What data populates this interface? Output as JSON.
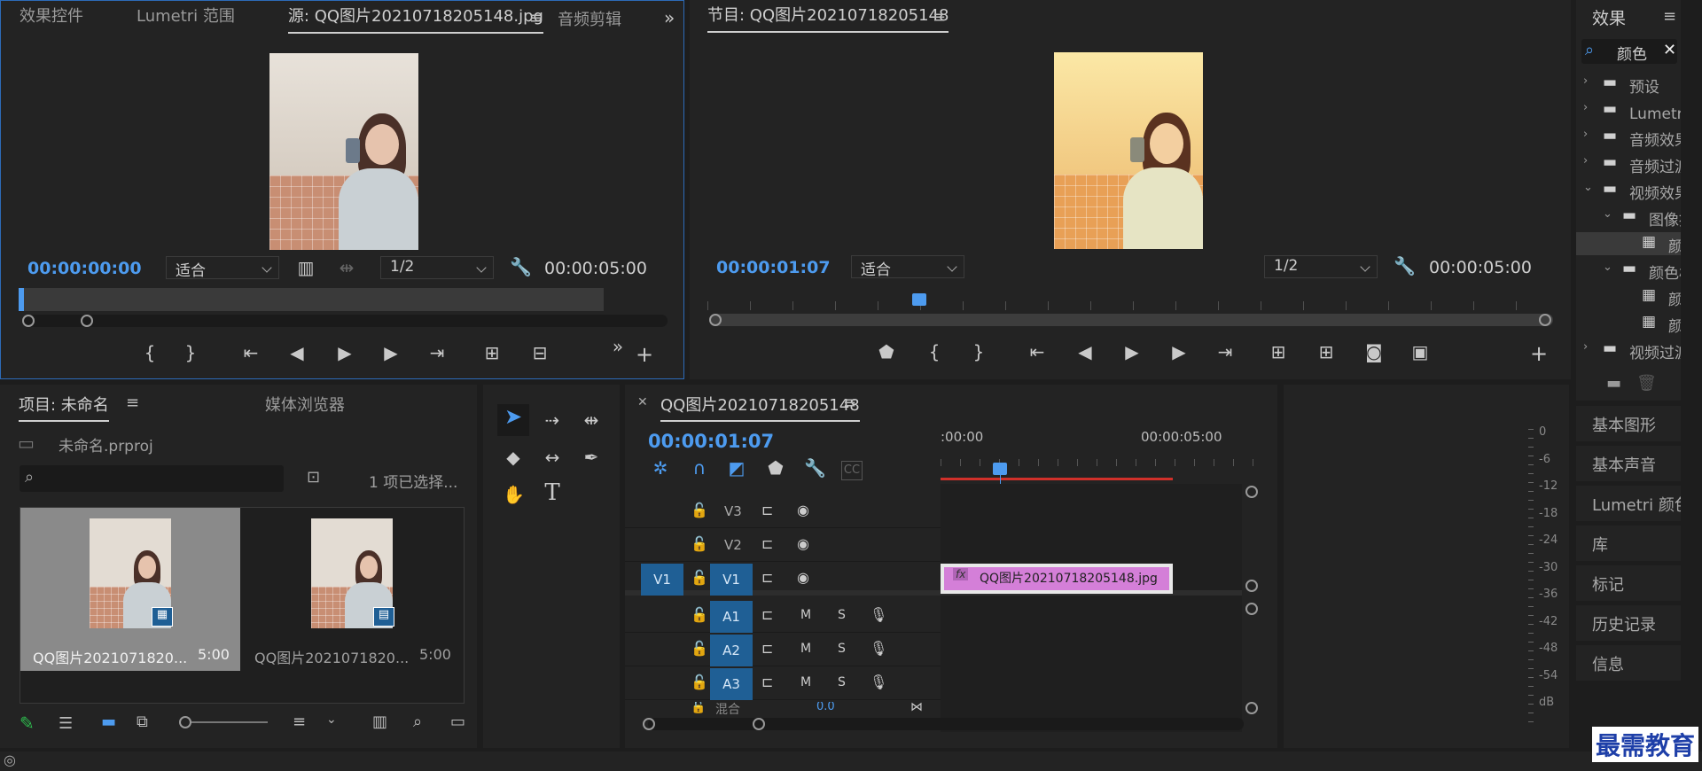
{
  "source_panel": {
    "tabs": [
      "效果控件",
      "Lumetri 范围",
      "源: QQ图片20210718205148.jpg",
      "音频剪辑"
    ],
    "menu_icon": "hamburger-icon",
    "timecode_current": "00:00:00:00",
    "zoom": "适合",
    "resolution": "1/2",
    "timecode_duration": "00:00:05:00"
  },
  "program_panel": {
    "title": "节目: QQ图片20210718205148",
    "timecode_current": "00:00:01:07",
    "zoom": "适合",
    "resolution": "1/2",
    "timecode_duration": "00:00:05:00"
  },
  "effects_panel": {
    "title": "效果",
    "search_value": "颜色",
    "tree": [
      {
        "label": "预设",
        "depth": 0,
        "expanded": false,
        "type": "folder"
      },
      {
        "label": "Lumetri 预设",
        "depth": 0,
        "expanded": false,
        "type": "folder"
      },
      {
        "label": "音频效果",
        "depth": 0,
        "expanded": false,
        "type": "folder"
      },
      {
        "label": "音频过渡",
        "depth": 0,
        "expanded": false,
        "type": "folder"
      },
      {
        "label": "视频效果",
        "depth": 0,
        "expanded": true,
        "type": "folder"
      },
      {
        "label": "图像控制",
        "depth": 1,
        "expanded": true,
        "type": "folder"
      },
      {
        "label": "颜色替换",
        "depth": 2,
        "type": "effect",
        "selected": true
      },
      {
        "label": "颜色校正",
        "depth": 1,
        "expanded": true,
        "type": "folder"
      },
      {
        "label": "颜色平衡",
        "depth": 2,
        "type": "effect"
      },
      {
        "label": "颜色",
        "depth": 2,
        "type": "effect"
      },
      {
        "label": "视频过渡",
        "depth": 0,
        "expanded": false,
        "type": "folder"
      }
    ]
  },
  "side_panels": [
    "基本图形",
    "基本声音",
    "Lumetri 颜色",
    "库",
    "标记",
    "历史记录",
    "信息"
  ],
  "project_panel": {
    "tabs": [
      "项目: 未命名",
      "媒体浏览器"
    ],
    "project_file": "未命名.prproj",
    "search_placeholder": "",
    "selection_status": "1 项已选择...",
    "items": [
      {
        "name": "QQ图片2021071820...",
        "duration": "5:00",
        "selected": true
      },
      {
        "name": "QQ图片2021071820...",
        "duration": "5:00",
        "selected": false
      }
    ]
  },
  "timeline": {
    "title": "QQ图片20210718205148",
    "timecode": "00:00:01:07",
    "ruler_labels": [
      ":00:00",
      "00:00:05:00"
    ],
    "video_tracks": [
      "V3",
      "V2",
      "V1"
    ],
    "audio_tracks": [
      "A1",
      "A2",
      "A3"
    ],
    "source_target": "V1",
    "mute": "M",
    "solo": "S",
    "mix_label": "混合",
    "mix_value": "0.0",
    "clip_label": "QQ图片20210718205148.jpg",
    "clip_fx": "fx",
    "playhead_fraction": 0.2567
  },
  "audio_meter": {
    "labels": [
      "0",
      "-6",
      "-12",
      "-18",
      "-24",
      "-30",
      "-36",
      "-42",
      "-48",
      "-54",
      "dB"
    ]
  },
  "watermark": "最需教育",
  "colors": {
    "accent_blue": "#4d9bef",
    "target_blue": "#1f5f95",
    "clip_pink": "#d47fd8",
    "work_area_red": "#d0302a"
  }
}
